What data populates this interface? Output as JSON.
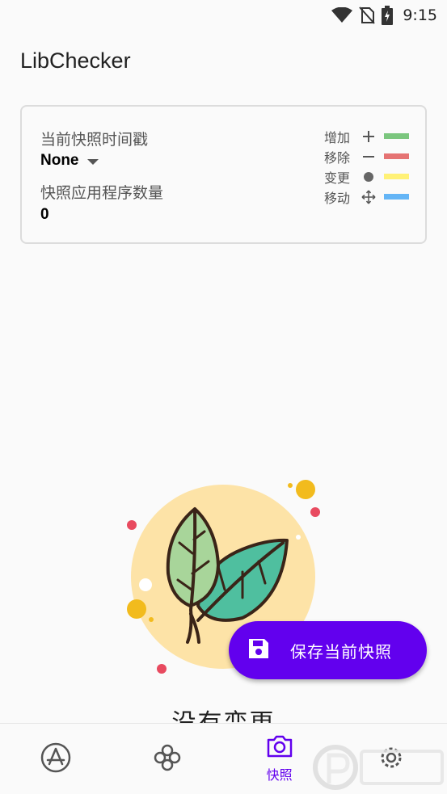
{
  "status_bar": {
    "time": "9:15",
    "icons": [
      "wifi-icon",
      "no-sim-icon",
      "battery-charging-icon"
    ]
  },
  "app": {
    "title": "LibChecker"
  },
  "snapshot_card": {
    "timestamp_label": "当前快照时间戳",
    "timestamp_value": "None",
    "app_count_label": "快照应用程序数量",
    "app_count_value": "0",
    "legend": [
      {
        "label": "增加",
        "symbol": "plus-icon",
        "color": "#7bc67e"
      },
      {
        "label": "移除",
        "symbol": "minus-icon",
        "color": "#e57373"
      },
      {
        "label": "变更",
        "symbol": "dot-icon",
        "color": "#fff176"
      },
      {
        "label": "移动",
        "symbol": "move-icon",
        "color": "#64b5f6"
      }
    ]
  },
  "empty_state": {
    "text": "没有变更"
  },
  "fab": {
    "label": "保存当前快照",
    "icon": "save-icon",
    "color": "#6200ee"
  },
  "bottom_nav": {
    "items": [
      {
        "name": "app-list",
        "icon": "app-store-icon",
        "label": ""
      },
      {
        "name": "statistics",
        "icon": "flower-icon",
        "label": ""
      },
      {
        "name": "snapshot",
        "icon": "camera-icon",
        "label": "快照",
        "active": true
      },
      {
        "name": "settings",
        "icon": "gear-icon",
        "label": ""
      }
    ],
    "active_color": "#6200ee"
  }
}
